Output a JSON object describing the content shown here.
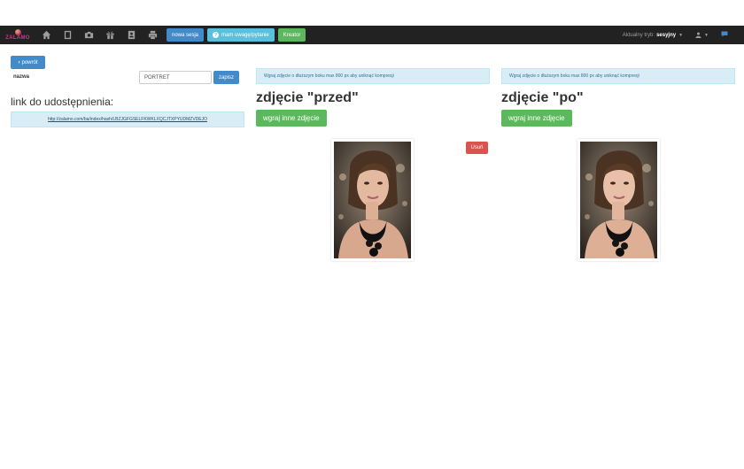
{
  "logo": {
    "text": "ZALAMO"
  },
  "nav": {
    "icons": [
      "home-icon",
      "book-icon",
      "camera-icon",
      "gift-icon",
      "contact-icon",
      "print-icon"
    ],
    "new_session": "nowa sesja",
    "feedback": "mam uwagę/pytanie",
    "creator": "Kreator",
    "mode_label": "Aktualny tryb:",
    "mode_value": "sesyjny",
    "colors": {
      "bar": "#222222",
      "blue": "#428bca",
      "cyan": "#5bc0de",
      "green": "#5cb85c"
    }
  },
  "left": {
    "back": "powrót",
    "name_label": "nazwa",
    "name_value": "PORTRET",
    "save": "zapisz",
    "share_title": "link do udostępnienia:",
    "share_link": "http://zalamo.com/ba/index/hash/LBZJGFGSELFKWKLXQCJTXPYUDMZVDEJO"
  },
  "before": {
    "info": "Wgraj zdjęcie o dłuższym boku max 800 px aby uniknąć kompresji",
    "title": "zdjęcie \"przed\"",
    "upload": "wgraj inne zdjęcie",
    "delete": "Usuń"
  },
  "after": {
    "info": "Wgraj zdjęcie o dłuższym boku max 800 px aby uniknąć kompresji",
    "title": "zdjęcie \"po\"",
    "upload": "wgraj inne zdjęcie"
  }
}
